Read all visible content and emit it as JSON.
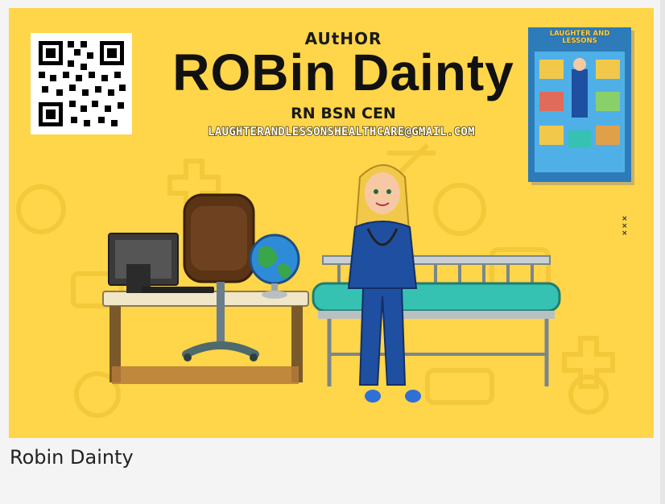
{
  "banner": {
    "author_label": "AUtHOR",
    "author_name": "ROBin Dainty",
    "credentials": "RN BSN CEN",
    "email": "LAUGHTERANDLESSONSHEALTHCARE@GMAIL.COM",
    "background_color": "#ffd54a",
    "qr_code_icon": "qr-code-icon"
  },
  "book": {
    "title": "LAUGHTER AND LESSONS",
    "cover_color": "#2d7bb8"
  },
  "caption": {
    "text": "Robin Dainty"
  }
}
